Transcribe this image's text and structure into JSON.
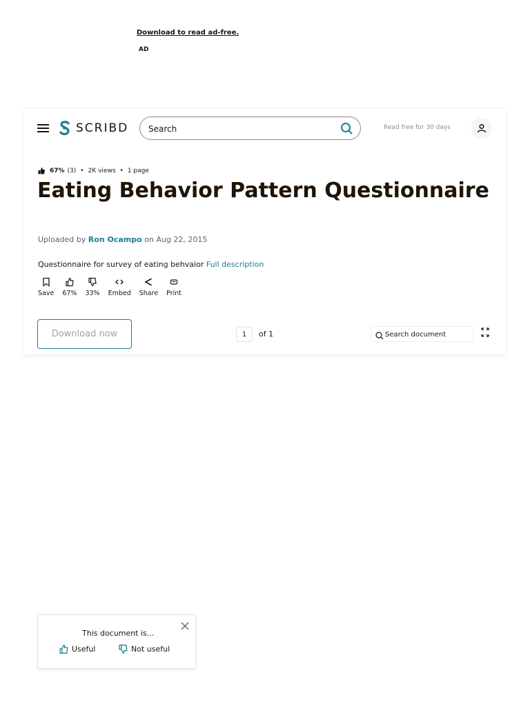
{
  "ad": {
    "link_text": "Download to read ad-free.",
    "label": "AD"
  },
  "header": {
    "logo_text": "SCRIBD",
    "search_placeholder": "Search",
    "read_free": "Read free for 30 days"
  },
  "doc": {
    "rating": "67%",
    "rating_count": "(3)",
    "views": "2K views",
    "pages": "1 page",
    "title": "Eating Behavior Pattern Questionnaire",
    "uploaded_prefix": "Uploaded by",
    "uploader": "Ron Ocampo",
    "uploaded_date": "on Aug 22, 2015",
    "description": "Questionnaire for survey of eating behvaior",
    "full_description": "Full description"
  },
  "actions": [
    {
      "label": "Save",
      "icon": "bookmark-icon"
    },
    {
      "label": "67%",
      "icon": "thumbs-up-icon"
    },
    {
      "label": "33%",
      "icon": "thumbs-down-icon"
    },
    {
      "label": "Embed",
      "icon": "code-icon"
    },
    {
      "label": "Share",
      "icon": "share-icon"
    },
    {
      "label": "Print",
      "icon": "print-icon"
    }
  ],
  "toolbar": {
    "download_label": "Download now",
    "page_value": "1",
    "page_of": "of 1",
    "search_doc_placeholder": "Search document"
  },
  "feedback": {
    "title": "This document is...",
    "useful": "Useful",
    "not_useful": "Not useful"
  },
  "colors": {
    "accent": "#1b7f8e",
    "text": "#1e1409",
    "muted": "#57617a"
  }
}
